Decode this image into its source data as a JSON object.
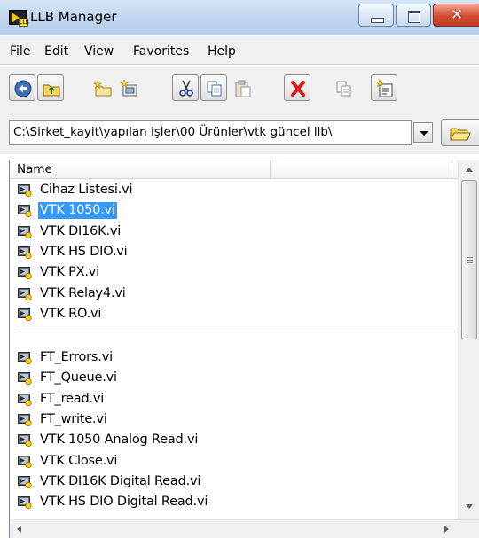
{
  "window": {
    "title": "LLB Manager",
    "controls": [
      "minimize",
      "maximize",
      "close"
    ],
    "close_glyph": "✕"
  },
  "app_icon": {
    "name": "llb-manager-icon",
    "badge": "LLB"
  },
  "menu": {
    "items": [
      "File",
      "Edit",
      "View",
      "Favorites",
      "Help"
    ]
  },
  "toolbar": {
    "buttons": [
      {
        "name": "back-button",
        "icon": "back-arrow-icon"
      },
      {
        "name": "up-folder-button",
        "icon": "folder-up-icon"
      },
      {
        "name": "new-folder-button",
        "icon": "new-folder-icon"
      },
      {
        "name": "new-llb-button",
        "icon": "new-llb-icon"
      },
      {
        "name": "cut-button",
        "icon": "scissors-icon"
      },
      {
        "name": "copy-button",
        "icon": "copy-icon"
      },
      {
        "name": "paste-button",
        "icon": "paste-icon"
      },
      {
        "name": "delete-button",
        "icon": "delete-x-icon"
      },
      {
        "name": "rename-button",
        "icon": "rename-icon"
      },
      {
        "name": "new-vi-button",
        "icon": "new-vi-icon"
      }
    ]
  },
  "path_bar": {
    "value": "C:\\Sirket_kayit\\yapılan işler\\00 Ürünler\\vtk güncel llb\\",
    "browse_icon": "folder-open-icon"
  },
  "list": {
    "column_header": "Name",
    "groups": [
      {
        "items": [
          {
            "name": "Cihaz Listesi.vi",
            "selected": false
          },
          {
            "name": "VTK 1050.vi",
            "selected": true
          },
          {
            "name": "VTK DI16K.vi",
            "selected": false
          },
          {
            "name": "VTK HS DIO.vi",
            "selected": false
          },
          {
            "name": "VTK PX.vi",
            "selected": false
          },
          {
            "name": "VTK Relay4.vi",
            "selected": false
          },
          {
            "name": "VTK RO.vi",
            "selected": false
          }
        ]
      },
      {
        "items": [
          {
            "name": "FT_Errors.vi",
            "selected": false
          },
          {
            "name": "FT_Queue.vi",
            "selected": false
          },
          {
            "name": "FT_read.vi",
            "selected": false
          },
          {
            "name": "FT_write.vi",
            "selected": false
          },
          {
            "name": "VTK 1050 Analog Read.vi",
            "selected": false
          },
          {
            "name": "VTK Close.vi",
            "selected": false
          },
          {
            "name": "VTK DI16K Digital Read.vi",
            "selected": false
          },
          {
            "name": "VTK HS DIO Digital Read.vi",
            "selected": false
          }
        ]
      }
    ],
    "selection_color": "#3399ff",
    "file_icon": "labview-vi-file-icon"
  }
}
